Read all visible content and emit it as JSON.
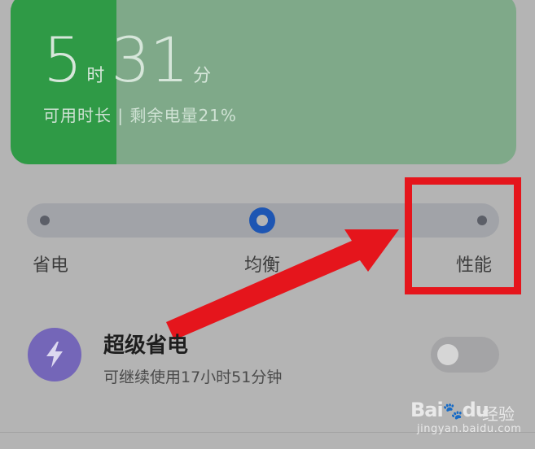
{
  "battery": {
    "hours": "5",
    "hours_unit": "时",
    "minutes": "31",
    "minutes_unit": "分",
    "subtitle": "可用时长 | 剩余电量21%",
    "level_percent": 21
  },
  "mode_slider": {
    "options": [
      "省电",
      "均衡",
      "性能"
    ],
    "selected": "均衡"
  },
  "super_saving": {
    "title": "超级省电",
    "description": "可继续使用17小时51分钟",
    "enabled": false,
    "icon": "lightning-bolt-icon"
  },
  "annotation": {
    "color": "#e5151c",
    "target": "性能"
  },
  "watermark": {
    "brand": "Bai",
    "brand_suffix": "du",
    "product": "经验",
    "url": "jingyan.baidu.com"
  },
  "colors": {
    "battery_fill": "#2f9a46",
    "battery_card": "#7fa989",
    "slider_knob": "#1e56b3",
    "super_icon_bg": "#7466b8"
  }
}
